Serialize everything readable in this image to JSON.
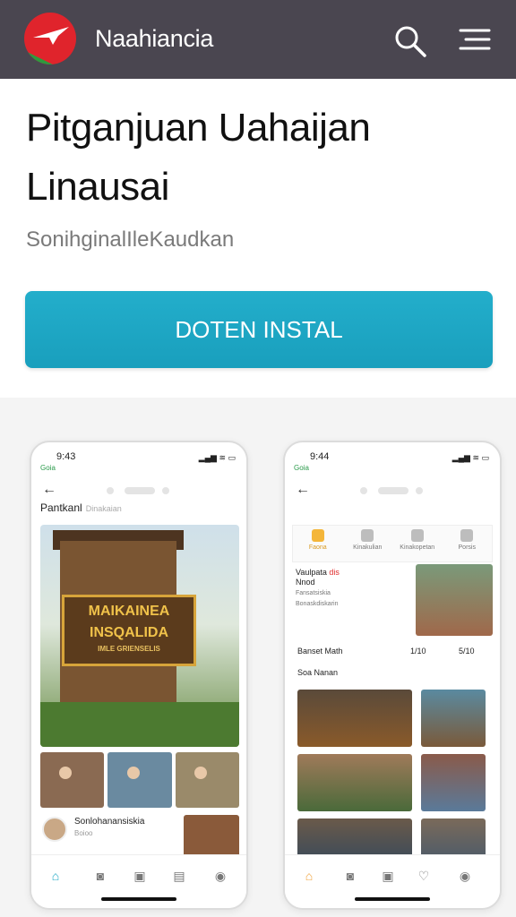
{
  "header": {
    "brand": "Naahiancia"
  },
  "hero": {
    "title": "Pitganjuan Uahaijan Linausai",
    "subtitle": "SonihginalIleKaudkan",
    "install_label": "DOTEN INSTAL"
  },
  "phone_left": {
    "time": "9:43",
    "header": "Pantkanl",
    "header_sub": "Dinakaian",
    "sign_line1": "MAIKAINEA",
    "sign_line2": "INSQALIDA",
    "sign_small": "IMLE GRIENSELIS",
    "user_name": "Sonlohanansiskia",
    "user_sub": "Boioo"
  },
  "phone_right": {
    "time": "9:44",
    "categories": [
      "Faona",
      "Kinakulian",
      "Kinakopetan",
      "Porsis"
    ],
    "news_title": "Vaulpata",
    "news_red": "dis",
    "news_line2": "Nnod",
    "news_line3": "Fansatsiskia",
    "news_line4": "Bonaskdiskarin",
    "row_label": "Banset Math",
    "row_value1": "1/10",
    "row_value2": "5/10",
    "row_label2": "Soa Nanan"
  },
  "colors": {
    "topbar": "#4a4650",
    "accent": "#1fa8c6"
  }
}
